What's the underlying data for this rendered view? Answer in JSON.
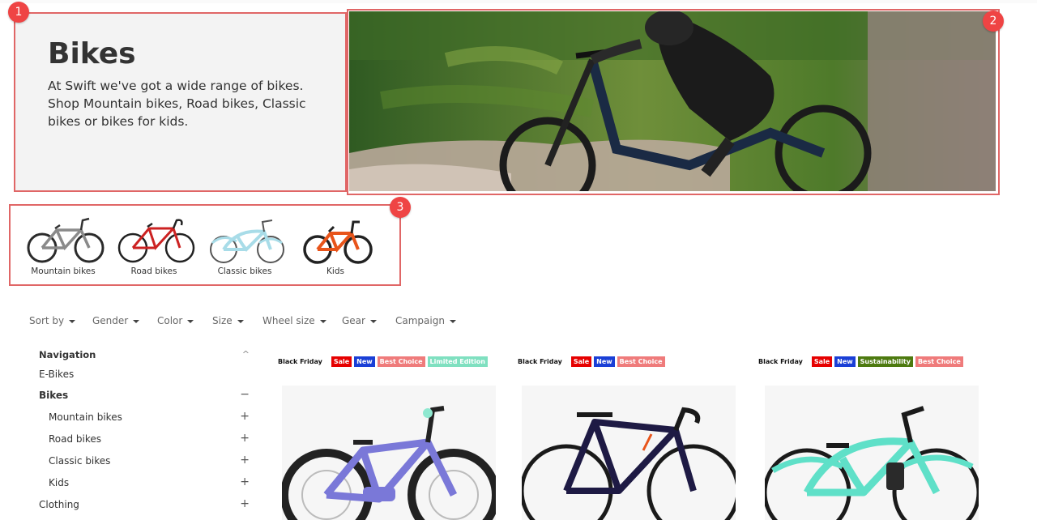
{
  "annotations": [
    "1",
    "2",
    "3"
  ],
  "hero": {
    "title": "Bikes",
    "description": "At Swift we've got a wide range of bikes. Shop Mountain bikes, Road bikes, Classic bikes or bikes for kids."
  },
  "categories": [
    {
      "label": "Mountain bikes",
      "frame_color": "#8a8a8a",
      "accent": "#2b2b2b"
    },
    {
      "label": "Road bikes",
      "frame_color": "#cc2222",
      "accent": "#222222"
    },
    {
      "label": "Classic bikes",
      "frame_color": "#a8dce8",
      "accent": "#555555"
    },
    {
      "label": "Kids",
      "frame_color": "#e8541a",
      "accent": "#222222"
    }
  ],
  "filters": [
    "Sort by",
    "Gender",
    "Color",
    "Size",
    "Wheel size",
    "Gear",
    "Campaign"
  ],
  "sidebar": {
    "heading": "Navigation",
    "collapse_symbol": "^",
    "items": [
      {
        "label": "E-Bikes",
        "symbol": ""
      },
      {
        "label": "Bikes",
        "symbol": "−"
      },
      {
        "label": "Mountain bikes",
        "symbol": "+"
      },
      {
        "label": "Road bikes",
        "symbol": "+"
      },
      {
        "label": "Classic bikes",
        "symbol": "+"
      },
      {
        "label": "Kids",
        "symbol": "+"
      },
      {
        "label": "Clothing",
        "symbol": "+"
      }
    ]
  },
  "tag_colors": {
    "Black Friday": "transparent",
    "Sale": "#e60000",
    "New": "#1a3fd6",
    "Best Choice": "#ef7b7b",
    "Limited Edition": "#7fe0c0",
    "Sustainability": "#4d7a0f"
  },
  "products": [
    {
      "tags": [
        "Black Friday",
        "Sale",
        "New",
        "Best Choice",
        "Limited Edition"
      ],
      "bike_color": "#7a78d8"
    },
    {
      "tags": [
        "Black Friday",
        "Sale",
        "New",
        "Best Choice"
      ],
      "bike_color": "#1e1a44"
    },
    {
      "tags": [
        "Black Friday",
        "Sale",
        "New",
        "Sustainability",
        "Best Choice"
      ],
      "bike_color": "#5fe0c8"
    }
  ]
}
